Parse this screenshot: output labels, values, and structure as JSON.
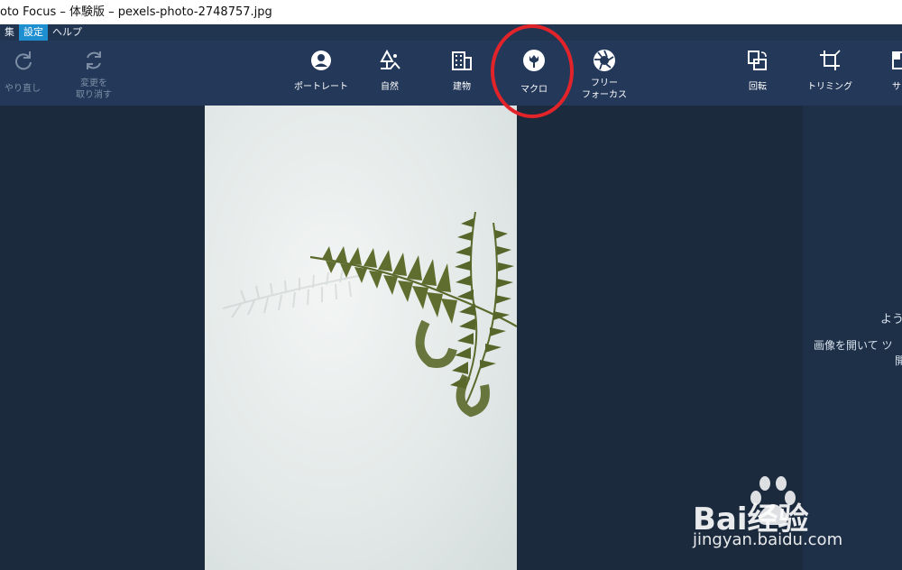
{
  "window": {
    "title": "oto Focus – 体験版 – pexels-photo-2748757.jpg"
  },
  "menu": {
    "items": [
      {
        "label": "集",
        "active": false
      },
      {
        "label": "設定",
        "active": true
      },
      {
        "label": "ヘルプ",
        "active": false
      }
    ]
  },
  "toolbar": {
    "redo": {
      "label": "やり直し",
      "icon": "redo-icon"
    },
    "undo_changes": {
      "label_line1": "変更を",
      "label_line2": "取り消す",
      "icon": "refresh-icon"
    },
    "portrait": {
      "label": "ポートレート",
      "icon": "portrait-icon"
    },
    "nature": {
      "label": "自然",
      "icon": "tree-icon"
    },
    "building": {
      "label": "建物",
      "icon": "building-icon"
    },
    "macro": {
      "label": "マクロ",
      "icon": "tulip-icon"
    },
    "free_focus": {
      "label_line1": "フリー",
      "label_line2": "フォーカス",
      "icon": "aperture-icon"
    },
    "rotate": {
      "label": "回転",
      "icon": "rotate-icon"
    },
    "trim": {
      "label": "トリミング",
      "icon": "crop-icon"
    },
    "size": {
      "label": "サイ",
      "icon": "resize-icon"
    }
  },
  "right_panel": {
    "welcome_title": "よう",
    "welcome_line1": "画像を開いて ツ",
    "welcome_line2": "開"
  },
  "watermark": {
    "brand": "Bai经验",
    "url": "jingyan.baidu.com"
  },
  "colors": {
    "toolbar_bg": "#24395a",
    "menubar_bg": "#213450",
    "workspace_bg": "#1b2a3d",
    "menu_active": "#1e8fd0",
    "highlight_circle": "#e2242a"
  }
}
